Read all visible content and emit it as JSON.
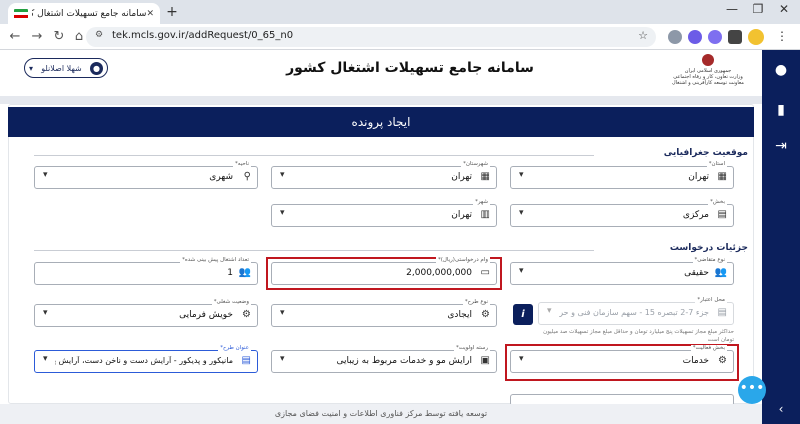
{
  "browser": {
    "tab_title": "سامانه جامع تسهیلات اشتغال کش...",
    "url": "tek.mcls.gov.ir/addRequest/0_65_n0"
  },
  "header": {
    "user_name": "شهلا اصلانلو",
    "app_title": "سامانه جامع تسهیلات اشتغال کشور",
    "logo_lines": [
      "جمهوری اسلامی ایران",
      "وزارت تعاون، کار و رفاه اجتماعی",
      "معاونت توسعه کارآفرینی و اشتغال"
    ]
  },
  "form": {
    "banner": "ایجاد پرونده",
    "section_geo": "موقعیت جغرافیایی",
    "section_request": "جزئیات درخواست",
    "fields": {
      "province": {
        "label": "استان*",
        "value": "تهران"
      },
      "county": {
        "label": "شهرستان*",
        "value": "تهران"
      },
      "area": {
        "label": "ناحیه*",
        "value": "شهری"
      },
      "district": {
        "label": "بخش*",
        "value": "مرکزی"
      },
      "city": {
        "label": "شهر*",
        "value": "تهران"
      },
      "applicant_type": {
        "label": "نوع متقاضی*",
        "value": "حقیقی"
      },
      "loan_amount": {
        "label": "وام درخواستی(ریال)*",
        "value": "2,000,000,000"
      },
      "jobs_count": {
        "label": "تعداد اشتغال پیش بینی شده*",
        "value": "1"
      },
      "credit_source": {
        "label": "محل اعتبار*",
        "value": "جزء 7-2 تبصره 15 - سهم سازمان فنی و حرفه ای"
      },
      "plan_type": {
        "label": "نوع طرح*",
        "value": "ایجادی"
      },
      "employment_status": {
        "label": "وضعیت شغلی*",
        "value": "خویش فرمایی"
      },
      "activity_sector": {
        "label": "بخش فعالیت*",
        "value": "خدمات"
      },
      "priority_field": {
        "label": "رسته اولویت*",
        "value": "آرایش مو و خدمات مربوط به زیبایی"
      },
      "project_title": {
        "label": "عنوان طرح*",
        "value": "مانیکور و پدیکور - آرایش دست و ناخن دست، آرایش پا و نا"
      }
    },
    "credit_note": "حداکثر مبلغ مجاز تسهیلات پنج میلیارد تومان و حداقل مبلغ مجاز تسهیلات صد میلیون تومان است"
  },
  "footer": "توسعه یافته توسط مرکز فناوری اطلاعات و امنیت فضای مجازی",
  "colors": {
    "navy": "#0b1f5c",
    "highlight": "#c0171f",
    "focus": "#2c5bd8",
    "fab": "#2aa7ea"
  }
}
